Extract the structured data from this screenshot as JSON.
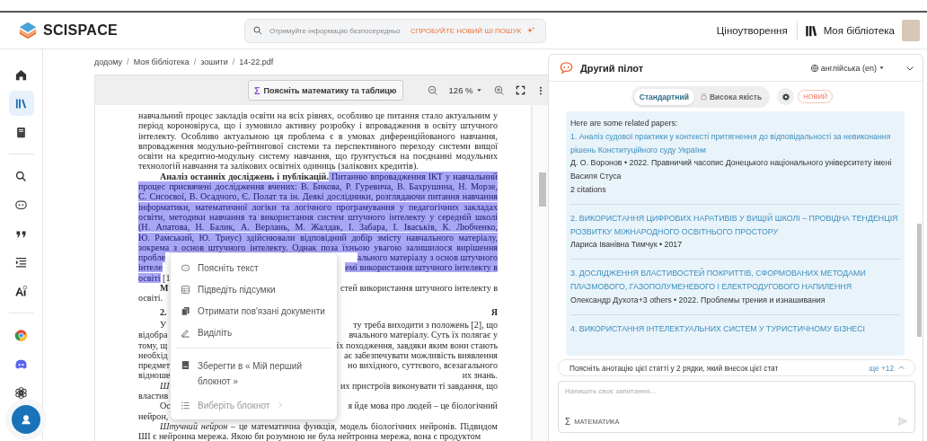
{
  "header": {
    "logo": "SCISPACE",
    "search": {
      "placeholder": "Отримуйте інформацію безпосередньо",
      "promo": "СПРОБУЙТЕ НОВИЙ ШІ ПОШУК"
    },
    "links": [
      "Ціноутворення",
      "Моя бібліотека"
    ]
  },
  "sidebar": {
    "items": [
      {
        "selected": false
      },
      {
        "selected": true
      },
      {
        "selected": false
      },
      {
        "selected": false
      },
      {
        "selected": false
      },
      {
        "selected": false
      },
      {
        "selected": false
      },
      {
        "selected": false
      },
      {
        "selected": false
      },
      {
        "selected": false
      },
      {
        "selected": false
      }
    ]
  },
  "breadcrumb": [
    {
      "label": "додому",
      "separator": "/"
    },
    {
      "label": "Моя бібліотека",
      "separator": "/"
    },
    {
      "label": "зошити",
      "separator": "/"
    },
    {
      "label": "14-22.pdf"
    }
  ],
  "pdf_toolbar": {
    "explain_icon": "Σ",
    "explain_button": "Поясніть математику та таблицю",
    "zoom": "126 %"
  },
  "document": {
    "paragraphs": [
      {
        "kind": "continued",
        "lines": [
          {
            "left": [
              {
                "text": "навчальний процес закладів освіти на всіх рівнях, особливо це питання стало актуальним у",
                "selected": false
              }
            ]
          },
          {
            "left": [
              {
                "text": "період короновіруса, що і зумовило активну розробку і впровадження в освіту штучного",
                "selected": false
              }
            ]
          },
          {
            "left": [
              {
                "text": "інтелекту. Особливо актуальною ця проблема є в умовах диференційованого навчання,",
                "selected": false
              }
            ]
          },
          {
            "left": [
              {
                "text": "впровадження модульно-рейтингової системи та перспективного переходу системи вищої",
                "selected": false
              }
            ]
          },
          {
            "left": [
              {
                "text": "освіти на кредитно-модульну систему навчання, що ґрунтується на поєднанні модульних",
                "selected": false
              }
            ]
          },
          {
            "left": [
              {
                "text": "технологій навчання та залікових освітніх одиниць (залікових кредитів).",
                "selected": false
              }
            ]
          }
        ]
      },
      {
        "kind": "paragraph",
        "lines": [
          {
            "left": [
              {
                "text": "**Аналіз останніх досліджень і публікацій.**",
                "selected": false
              },
              {
                "text": " Питанню впровадження ІКТ у навчальний",
                "selected": true
              }
            ]
          },
          {
            "left": [
              {
                "text": "процес присвячені дослідження вчених: В. Бикова, Р. Гуревича, В. Бахрушина, Н. Морзе,",
                "selected": true
              }
            ]
          },
          {
            "left": [
              {
                "text": "С. Сисоєвої, В. Осадчого, Є. Полат та ін. Деякі дослідники, розглядаючи питання навчання",
                "selected": true
              }
            ]
          },
          {
            "left": [
              {
                "text": "інформатики, математичної логіки та логічного програмування у педагогічних закладах",
                "selected": true
              }
            ]
          },
          {
            "left": [
              {
                "text": "освіти, методики навчання та використання систем штучного інтелекту у середній школі",
                "selected": true
              }
            ]
          },
          {
            "left": [
              {
                "text": "(Н. Апатова, Н. Балик, А. Верлань, М. Жалдак, І. Забара, І. Іваськів, К. Любченко,",
                "selected": true
              }
            ]
          },
          {
            "left": [
              {
                "text": "Ю. Рамський, Ю. Триус) здійснювали відповідний добір змісту навчального матеріалу,",
                "selected": true
              }
            ]
          },
          {
            "left": [
              {
                "text": "зокрема з основ штучного інтелекту. Однак поза їхньою увагою залишилося вирішення",
                "selected": true
              }
            ]
          },
          {
            "left": [
              {
                "text": "пробле",
                "selected": true
              }
            ],
            "right": [
              {
                "text": "ального матеріалу з основ штучного",
                "selected": true
              }
            ]
          },
          {
            "left": [
              {
                "text": "інтеле",
                "selected": true
              }
            ],
            "right": [
              {
                "text": "емі використання штучного інтелекту в",
                "selected": true
              }
            ]
          },
          {
            "left": [
              {
                "text": "освіті",
                "selected": true
              },
              {
                "text": " [1",
                "selected": false
              }
            ]
          }
        ]
      },
      {
        "kind": "paragraph",
        "lines": [
          {
            "left": [
              {
                "text": "**М**",
                "selected": false
              }
            ],
            "right": [
              {
                "text": "стей використання штучного інтелекту в",
                "selected": false
              }
            ]
          },
          {
            "left": [
              {
                "text": "освіті.",
                "selected": false
              }
            ]
          }
        ]
      },
      {
        "kind": "heading",
        "lines": [
          {
            "left": [
              {
                "text": "2.",
                "selected": false
              }
            ],
            "right": [
              {
                "text": "Я",
                "selected": false
              }
            ]
          }
        ]
      },
      {
        "kind": "paragraph",
        "lines": [
          {
            "left": [
              {
                "text": "У",
                "selected": false
              }
            ],
            "right": [
              {
                "text": "ту треба виходити з положень [2], що",
                "selected": false
              }
            ]
          },
          {
            "left": [
              {
                "text": "відобра",
                "selected": false
              }
            ],
            "right": [
              {
                "text": "вчального матеріалу. Суть їх полягає у",
                "selected": false
              }
            ]
          },
          {
            "left": [
              {
                "text": "тому, щ",
                "selected": false
              }
            ],
            "right": [
              {
                "text": "їх походження, завдяки яким вони стають",
                "selected": false
              }
            ]
          },
          {
            "left": [
              {
                "text": "необхід",
                "selected": false
              }
            ],
            "right": [
              {
                "text": "ає забезпечувати можливість виявлення",
                "selected": false
              }
            ]
          },
          {
            "left": [
              {
                "text": "предмет",
                "selected": false
              }
            ],
            "right": [
              {
                "text": "но вихідного, суттєвого, всезагального",
                "selected": false
              }
            ]
          },
          {
            "left": [
              {
                "text": "відноше",
                "selected": false
              }
            ],
            "right": [
              {
                "text": "их знань.",
                "selected": false
              }
            ]
          }
        ]
      },
      {
        "kind": "paragraph",
        "lines": [
          {
            "left": [
              {
                "text": "*Ш*",
                "selected": false
              }
            ],
            "right": [
              {
                "text": "их пристроїв виконувати ті завдання, що",
                "selected": false
              }
            ]
          },
          {
            "left": [
              {
                "text": "властив",
                "selected": false
              }
            ]
          }
        ]
      },
      {
        "kind": "paragraph",
        "lines": [
          {
            "left": [
              {
                "text": "Ос",
                "selected": false
              }
            ],
            "right": [
              {
                "text": "я йде мова про людей – це біологічний",
                "selected": false
              }
            ]
          },
          {
            "left": [
              {
                "text": "нейрон,",
                "selected": false
              }
            ]
          }
        ]
      },
      {
        "kind": "paragraph",
        "lines": [
          {
            "left": [
              {
                "text": "*Штучний нейрон* – це математична функція, модель біологічних нейронів. Підвидом",
                "selected": false
              }
            ]
          },
          {
            "left": [
              {
                "text": "ШІ є нейронна мережа. Якою би розумною не була нейтронна мережа, вона є продуктом",
                "selected": false
              }
            ]
          }
        ]
      }
    ]
  },
  "context_menu": {
    "items": [
      {
        "label": "Поясніть текст",
        "kind": "action",
        "disabled": false
      },
      {
        "label": "Підведіть підсумки",
        "kind": "action",
        "disabled": false
      },
      {
        "label": "Отримати пов'язані документи",
        "kind": "action",
        "disabled": false
      },
      {
        "label": "Виділіть",
        "kind": "action",
        "disabled": false
      },
      {
        "label": "Зберегти в « Мій перший блокнот »",
        "kind": "action",
        "disabled": false
      },
      {
        "label": "Виберіть блокнот",
        "kind": "submenu",
        "disabled": true
      }
    ]
  },
  "copilot": {
    "title": "Другий пілот",
    "language": "англійська (en)",
    "modes": [
      {
        "label": "Стандартний",
        "selected": true,
        "locked": false
      },
      {
        "label": "Висока якість",
        "selected": false,
        "locked": true
      }
    ],
    "badge": "НОВИЙ",
    "intro": "Here are some related papers:",
    "papers": [
      {
        "number": "1.",
        "title": "Аналіз судової практики у контексті притягнення до відповідальності за невиконання рішень Конституційного суду України",
        "meta": "Д. О. Воронов • 2022. Правничий часопис Донецького національного університету імені Василя Стуса",
        "citations": "2 citations"
      },
      {
        "number": "2.",
        "title": "ВИКОРИСТАННЯ ЦИФРОВИХ НАРАТИВІВ У ВИЩІЙ ШКОЛІ – ПРОВІДНА ТЕНДЕНЦІЯ РОЗВИТКУ МІЖНАРОДНОГО ОСВІТНЬОГО ПРОСТОРУ",
        "meta": "Лариса Іванівна Тимчук • 2017"
      },
      {
        "number": "3.",
        "title": "ДОСЛІДЖЕННЯ ВЛАСТИВОСТЕЙ ПОКРИТТІВ, СФОРМОВАНИХ МЕТОДАМИ ПЛАЗМОВОГО, ГАЗОПОЛУМЕНЕВОГО І ЕЛЕКТРОДУГОВОГО НАПИЛЕННЯ",
        "meta": "Олександр Духота+3 others • 2022. Проблемы трения и изнашивания"
      },
      {
        "number": "4.",
        "title": "ВИКОРИСТАННЯ ІНТЕЛЕКТУАЛЬНИХ СИСТЕМ У ТУРИСТИЧНОМУ БІЗНЕСІ"
      }
    ],
    "suggestion": "Поясніть анотацію цієї статті у 2 рядки, який внесок цієї стат",
    "more": "ще +12",
    "input": {
      "placeholder": "Напишіть своє запитання...",
      "math_icon": "Σ",
      "math": "МАТЕМАТИКА"
    }
  }
}
